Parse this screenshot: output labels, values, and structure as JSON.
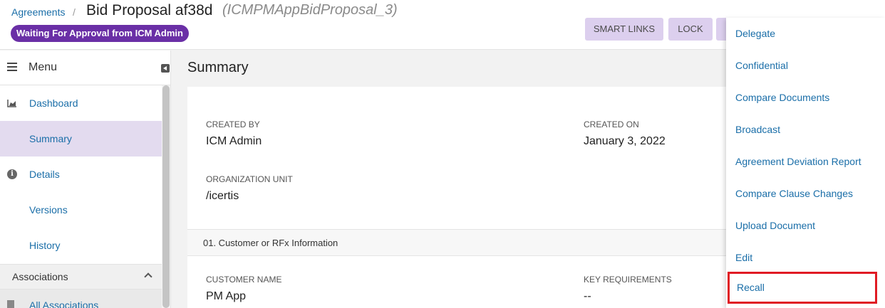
{
  "header": {
    "breadcrumb": "Agreements",
    "separator": "/",
    "title": "Bid Proposal af38d",
    "subtitle": "(ICMPMAppBidProposal_3)",
    "status_badge": "Waiting For Approval from ICM Admin",
    "buttons": {
      "smart_links": "SMART LINKS",
      "lock": "LOCK"
    }
  },
  "sidebar": {
    "menu_label": "Menu",
    "items": [
      {
        "label": "Dashboard",
        "icon": "area-chart-icon",
        "active": false
      },
      {
        "label": "Summary",
        "icon": "",
        "active": true
      },
      {
        "label": "Details",
        "icon": "info-icon",
        "active": false
      },
      {
        "label": "Versions",
        "icon": "",
        "active": false
      },
      {
        "label": "History",
        "icon": "",
        "active": false
      }
    ],
    "associations": {
      "label": "Associations",
      "sub_label": "All Associations"
    }
  },
  "main": {
    "title": "Summary",
    "fields": {
      "created_by_label": "CREATED BY",
      "created_by_value": "ICM Admin",
      "created_on_label": "CREATED ON",
      "created_on_value": "January 3, 2022",
      "org_unit_label": "ORGANIZATION UNIT",
      "org_unit_value": "/icertis",
      "customer_name_label": "CUSTOMER NAME",
      "customer_name_value": "PM App",
      "key_req_label": "KEY REQUIREMENTS",
      "key_req_value": "--"
    },
    "section_title": "01. Customer or RFx Information"
  },
  "dropdown": {
    "items": [
      "Delegate",
      "Confidential",
      "Compare Documents",
      "Broadcast",
      "Agreement Deviation Report",
      "Compare Clause Changes",
      "Upload Document",
      "Edit",
      "Recall"
    ],
    "highlighted": "Recall"
  },
  "colors": {
    "status_badge": "#6a2fa6",
    "button_bg": "#dccfee",
    "link": "#1a6ea8",
    "active_nav": "#e3dbef",
    "highlight_border": "#e01b24"
  }
}
